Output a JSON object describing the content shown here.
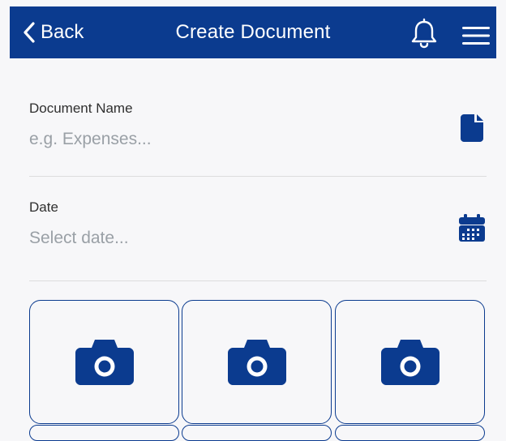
{
  "header": {
    "back_label": "Back",
    "title": "Create Document",
    "bell_icon": "bell-icon",
    "menu_icon": "hamburger-menu-icon",
    "bg_color": "#0b3b8f"
  },
  "form": {
    "document_name": {
      "label": "Document Name",
      "placeholder": "e.g. Expenses...",
      "icon": "document-icon"
    },
    "date": {
      "label": "Date",
      "placeholder": "Select date...",
      "icon": "calendar-icon"
    }
  },
  "photos": {
    "tiles": [
      {
        "icon": "camera-icon"
      },
      {
        "icon": "camera-icon"
      },
      {
        "icon": "camera-icon"
      }
    ],
    "accent_color": "#0b3b8f"
  }
}
